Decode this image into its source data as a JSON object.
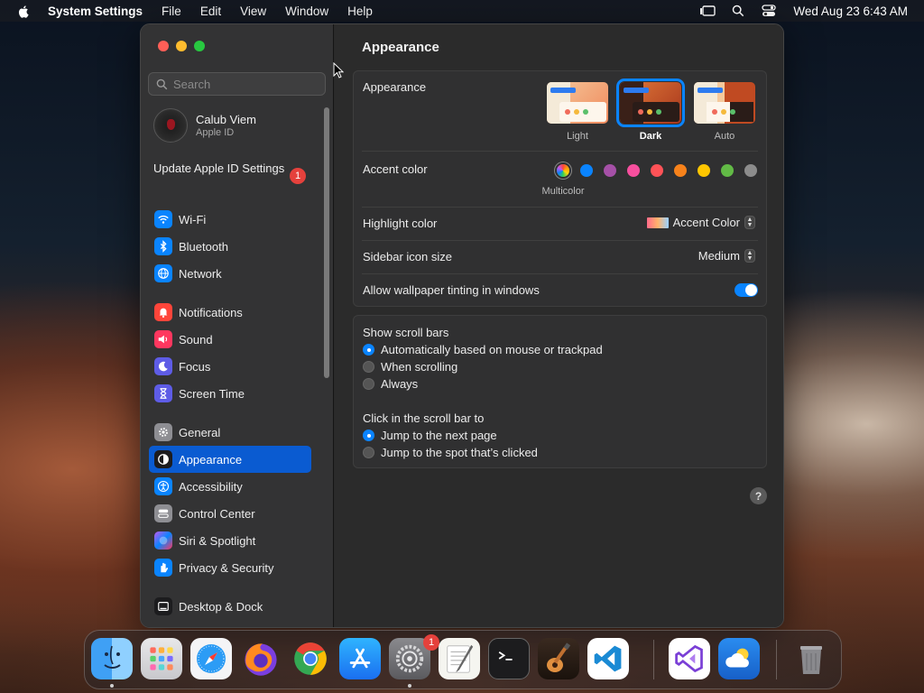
{
  "menubar": {
    "app_name": "System Settings",
    "items": [
      "File",
      "Edit",
      "View",
      "Window",
      "Help"
    ],
    "clock": "Wed Aug 23  6:43 AM"
  },
  "sidebar": {
    "search_placeholder": "Search",
    "profile": {
      "name": "Calub Viem",
      "subtitle": "Apple ID"
    },
    "update": {
      "label": "Update Apple ID Settings",
      "badge": "1"
    },
    "groups": [
      [
        {
          "label": "Wi-Fi",
          "icon": "wifi-icon",
          "color": "#0a84ff"
        },
        {
          "label": "Bluetooth",
          "icon": "bluetooth-icon",
          "color": "#0a84ff"
        },
        {
          "label": "Network",
          "icon": "globe-icon",
          "color": "#0a84ff"
        }
      ],
      [
        {
          "label": "Notifications",
          "icon": "bell-icon",
          "color": "#ff453a"
        },
        {
          "label": "Sound",
          "icon": "speaker-icon",
          "color": "#ff375f"
        },
        {
          "label": "Focus",
          "icon": "moon-icon",
          "color": "#5e5ce6"
        },
        {
          "label": "Screen Time",
          "icon": "hourglass-icon",
          "color": "#5e5ce6"
        }
      ],
      [
        {
          "label": "General",
          "icon": "gear-icon",
          "color": "#8e8e93"
        },
        {
          "label": "Appearance",
          "icon": "appearance-icon",
          "color": "#1c1c1e",
          "active": true
        },
        {
          "label": "Accessibility",
          "icon": "accessibility-icon",
          "color": "#0a84ff"
        },
        {
          "label": "Control Center",
          "icon": "control-center-icon",
          "color": "#8e8e93"
        },
        {
          "label": "Siri & Spotlight",
          "icon": "siri-icon",
          "color": "#bf5af2"
        },
        {
          "label": "Privacy & Security",
          "icon": "hand-icon",
          "color": "#0a84ff"
        }
      ],
      [
        {
          "label": "Desktop & Dock",
          "icon": "dock-icon",
          "color": "#1c1c1e"
        }
      ]
    ]
  },
  "content": {
    "title": "Appearance",
    "appearance": {
      "label": "Appearance",
      "options": [
        {
          "label": "Light",
          "selected": false
        },
        {
          "label": "Dark",
          "selected": true
        },
        {
          "label": "Auto",
          "selected": false
        }
      ]
    },
    "accent": {
      "label": "Accent color",
      "selected_caption": "Multicolor",
      "colors": [
        "#ff9f0a",
        "#0a84ff",
        "#a550a7",
        "#f74f9e",
        "#ff5257",
        "#f7821b",
        "#ffc600",
        "#62ba46",
        "#8c8c8c"
      ]
    },
    "highlight": {
      "label": "Highlight color",
      "value": "Accent Color"
    },
    "sidebar_icon_size": {
      "label": "Sidebar icon size",
      "value": "Medium"
    },
    "wallpaper_tinting": {
      "label": "Allow wallpaper tinting in windows",
      "enabled": true
    },
    "scroll_bars": {
      "label": "Show scroll bars",
      "options": [
        {
          "label": "Automatically based on mouse or trackpad",
          "selected": true
        },
        {
          "label": "When scrolling",
          "selected": false
        },
        {
          "label": "Always",
          "selected": false
        }
      ]
    },
    "click_scroll": {
      "label": "Click in the scroll bar to",
      "options": [
        {
          "label": "Jump to the next page",
          "selected": true
        },
        {
          "label": "Jump to the spot that’s clicked",
          "selected": false
        }
      ]
    },
    "help": "?"
  },
  "dock": {
    "settings_badge": "1"
  }
}
